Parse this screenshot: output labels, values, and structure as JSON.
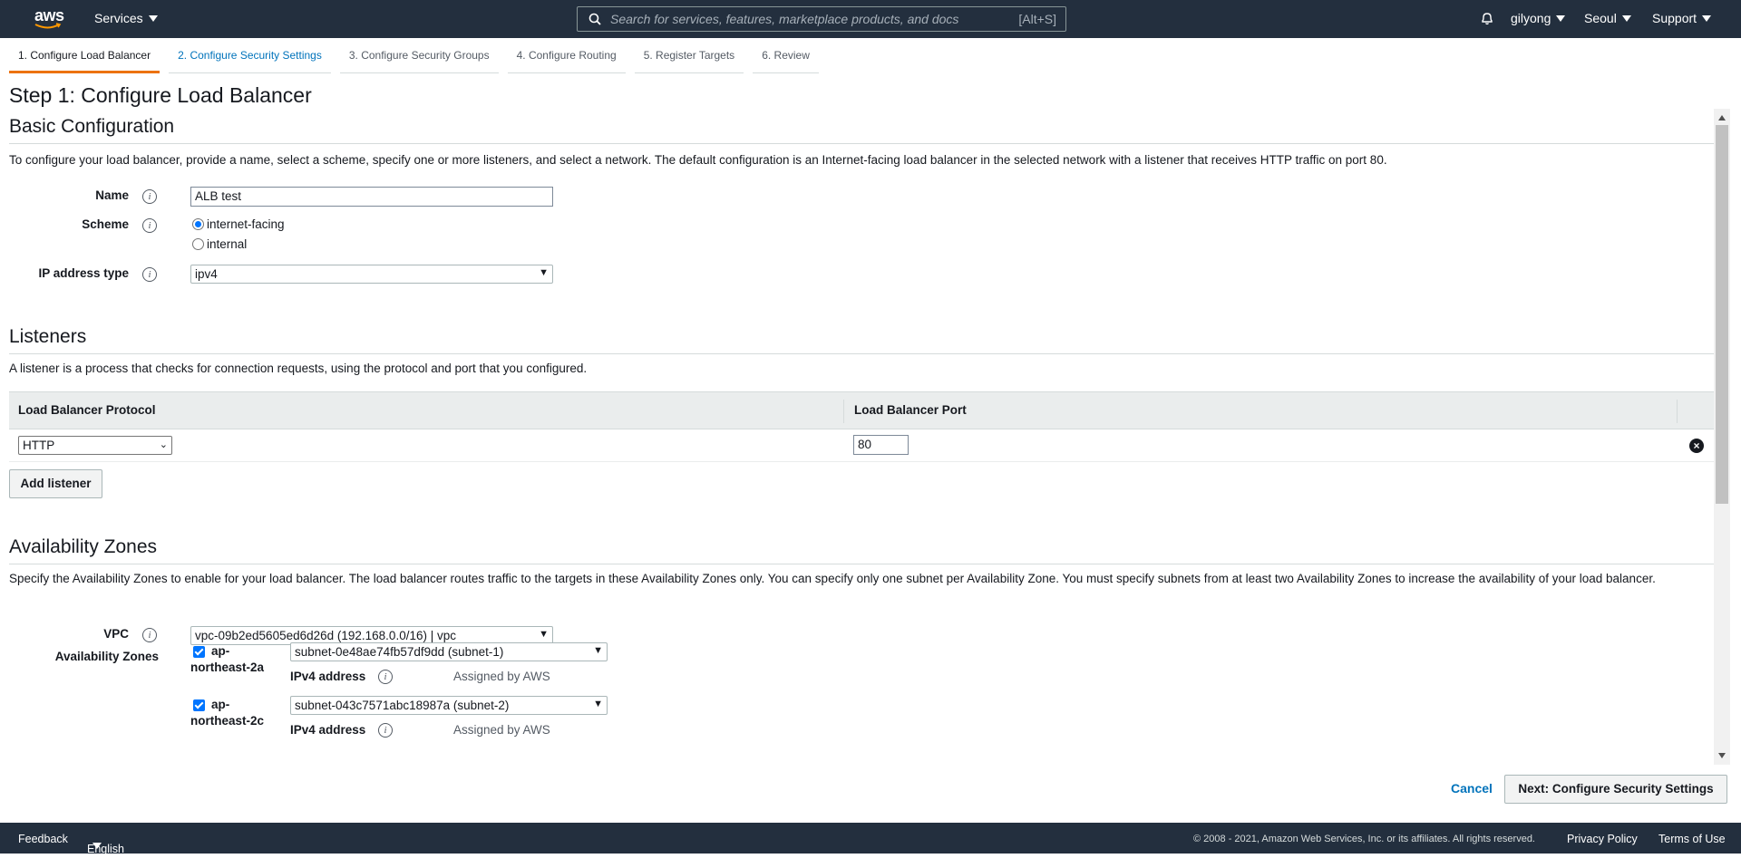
{
  "topnav": {
    "logo_text": "aws",
    "services_label": "Services",
    "search_placeholder": "Search for services, features, marketplace products, and docs",
    "search_shortcut": "[Alt+S]",
    "user": "gilyong",
    "region": "Seoul",
    "support": "Support"
  },
  "wizard": {
    "tabs": [
      {
        "label": "1. Configure Load Balancer"
      },
      {
        "label": "2. Configure Security Settings"
      },
      {
        "label": "3. Configure Security Groups"
      },
      {
        "label": "4. Configure Routing"
      },
      {
        "label": "5. Register Targets"
      },
      {
        "label": "6. Review"
      }
    ],
    "active_tab": 0
  },
  "step_title": "Step 1: Configure Load Balancer",
  "basic": {
    "heading": "Basic Configuration",
    "description": "To configure your load balancer, provide a name, select a scheme, specify one or more listeners, and select a network. The default configuration is an Internet-facing load balancer in the selected network with a listener that receives HTTP traffic on port 80.",
    "name_label": "Name",
    "name_value": "ALB test",
    "scheme_label": "Scheme",
    "scheme_options": [
      "internet-facing",
      "internal"
    ],
    "scheme_selected": "internet-facing",
    "ip_label": "IP address type",
    "ip_value": "ipv4"
  },
  "listeners": {
    "heading": "Listeners",
    "description": "A listener is a process that checks for connection requests, using the protocol and port that you configured.",
    "col_protocol": "Load Balancer Protocol",
    "col_port": "Load Balancer Port",
    "rows": [
      {
        "protocol": "HTTP",
        "port": "80"
      }
    ],
    "add_label": "Add listener"
  },
  "az": {
    "heading": "Availability Zones",
    "description": "Specify the Availability Zones to enable for your load balancer. The load balancer routes traffic to the targets in these Availability Zones only. You can specify only one subnet per Availability Zone. You must specify subnets from at least two Availability Zones to increase the availability of your load balancer.",
    "vpc_label": "VPC",
    "vpc_value": "vpc-09b2ed5605ed6d26d (192.168.0.0/16) | vpc",
    "zones_label": "Availability Zones",
    "zones": [
      {
        "name_line1": "ap-",
        "name_line2": "northeast-2a",
        "subnet": "subnet-0e48ae74fb57df9dd (subnet-1)",
        "ipv4_label": "IPv4 address",
        "ipv4_value": "Assigned by AWS"
      },
      {
        "name_line1": "ap-",
        "name_line2": "northeast-2c",
        "subnet": "subnet-043c7571abc18987a (subnet-2)",
        "ipv4_label": "IPv4 address",
        "ipv4_value": "Assigned by AWS"
      }
    ]
  },
  "actions": {
    "cancel": "Cancel",
    "next": "Next: Configure Security Settings"
  },
  "footer": {
    "feedback": "Feedback",
    "language": "English (US)",
    "copyright": "© 2008 - 2021, Amazon Web Services, Inc. or its affiliates. All rights reserved.",
    "privacy": "Privacy Policy",
    "terms": "Terms of Use"
  },
  "colors": {
    "nav_bg": "#232f3e",
    "accent": "#ec7211",
    "link": "#0073bb"
  }
}
